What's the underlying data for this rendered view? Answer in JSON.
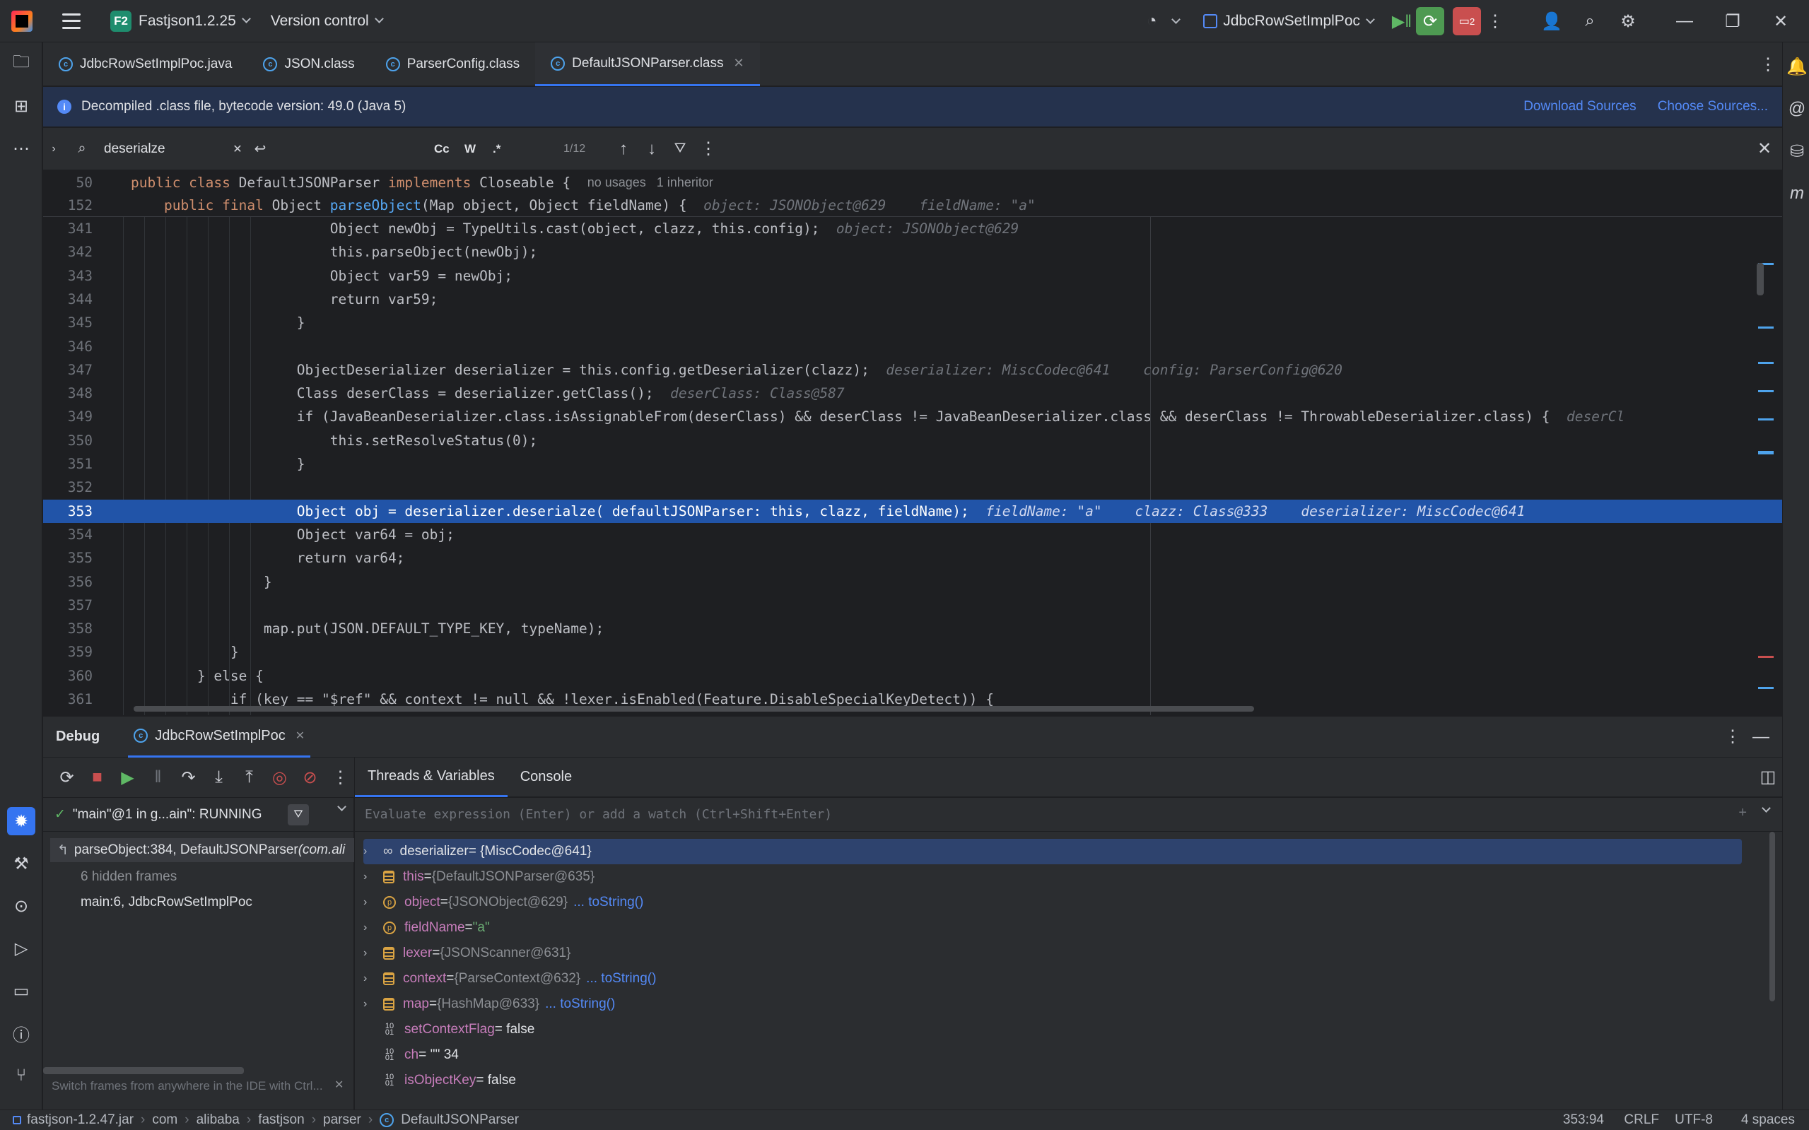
{
  "titlebar": {
    "project_badge": "F2",
    "project": "Fastjson1.2.25",
    "vcs": "Version control",
    "run_config": "JdbcRowSetImplPoc",
    "debug_badge": "2"
  },
  "tabs": [
    {
      "label": "JdbcRowSetImplPoc.java"
    },
    {
      "label": "JSON.class"
    },
    {
      "label": "ParserConfig.class"
    },
    {
      "label": "DefaultJSONParser.class"
    }
  ],
  "banner": {
    "text": "Decompiled .class file, bytecode version: 49.0 (Java 5)",
    "download": "Download Sources",
    "choose": "Choose Sources..."
  },
  "search": {
    "value": "deserialze",
    "count": "1/12",
    "cc": "Cc",
    "w": "W",
    "regex": ".*"
  },
  "code": {
    "sticky1": {
      "ln": "50",
      "a": "public class ",
      "b": "DefaultJSONParser ",
      "c": "implements ",
      "d": "Closeable {  ",
      "e": "no usages   1 inheritor"
    },
    "sticky2": {
      "ln": "152",
      "a": "    public final ",
      "b": "Object ",
      "c": "parseObject",
      "d": "(Map object, Object fieldName) {  ",
      "e": "object: JSONObject@629    fieldName: \"a\""
    },
    "lines": [
      {
        "ln": "341",
        "t": "                        Object newObj = TypeUtils.cast(object, clazz, this.config);",
        "h": "  object: JSONObject@629"
      },
      {
        "ln": "342",
        "t": "                        this.parseObject(newObj);",
        "h": ""
      },
      {
        "ln": "343",
        "t": "                        Object var59 = newObj;",
        "h": ""
      },
      {
        "ln": "344",
        "t": "                        return var59;",
        "h": ""
      },
      {
        "ln": "345",
        "t": "                    }",
        "h": ""
      },
      {
        "ln": "346",
        "t": "",
        "h": ""
      },
      {
        "ln": "347",
        "t": "                    ObjectDeserializer deserializer = this.config.getDeserializer(clazz);",
        "h": "  deserializer: MiscCodec@641    config: ParserConfig@620"
      },
      {
        "ln": "348",
        "t": "                    Class deserClass = deserializer.getClass();",
        "h": "  deserClass: Class@587"
      },
      {
        "ln": "349",
        "t": "                    if (JavaBeanDeserializer.class.isAssignableFrom(deserClass) && deserClass != JavaBeanDeserializer.class && deserClass != ThrowableDeserializer.class) {",
        "h": "  deserCl"
      },
      {
        "ln": "350",
        "t": "                        this.setResolveStatus(0);",
        "h": ""
      },
      {
        "ln": "351",
        "t": "                    }",
        "h": ""
      },
      {
        "ln": "352",
        "t": "",
        "h": ""
      },
      {
        "ln": "353",
        "t": "                    Object obj = deserializer.deserialze( defaultJSONParser: this, clazz, fieldName);",
        "h": "  fieldName: \"a\"    clazz: Class@333    deserializer: MiscCodec@641"
      },
      {
        "ln": "354",
        "t": "                    Object var64 = obj;",
        "h": ""
      },
      {
        "ln": "355",
        "t": "                    return var64;",
        "h": ""
      },
      {
        "ln": "356",
        "t": "                }",
        "h": ""
      },
      {
        "ln": "357",
        "t": "",
        "h": ""
      },
      {
        "ln": "358",
        "t": "                map.put(JSON.DEFAULT_TYPE_KEY, typeName);",
        "h": ""
      },
      {
        "ln": "359",
        "t": "            }",
        "h": ""
      },
      {
        "ln": "360",
        "t": "        } else {",
        "h": ""
      },
      {
        "ln": "361",
        "t": "            if (key == \"$ref\" && context != null && !lexer.isEnabled(Feature.DisableSpecialKeyDetect)) {",
        "h": ""
      }
    ]
  },
  "debug": {
    "title": "Debug",
    "session": "JdbcRowSetImplPoc",
    "threads_tab": "Threads & Variables",
    "console_tab": "Console",
    "thread": "\"main\"@1 in g...ain\": RUNNING",
    "frames": [
      {
        "label": "parseObject:384, DefaultJSONParser ",
        "pkg": "(com.ali"
      },
      {
        "label": "6 hidden frames"
      },
      {
        "label": "main:6, JdbcRowSetImplPoc"
      }
    ],
    "hint": "Switch frames from anywhere in the IDE with Ctrl...",
    "eval_placeholder": "Evaluate expression (Enter) or add a watch (Ctrl+Shift+Enter)",
    "vars": [
      {
        "name": "deserializer",
        "eq": " = {MiscCodec@641}",
        "type": "",
        "link": ""
      },
      {
        "name": "this",
        "eq": " = ",
        "type": "{DefaultJSONParser@635}",
        "link": ""
      },
      {
        "name": "object",
        "eq": " = ",
        "type": "{JSONObject@629}",
        "link": "... toString()"
      },
      {
        "name": "fieldName",
        "eq": " = ",
        "type": "",
        "link": "",
        "str": "\"a\""
      },
      {
        "name": "lexer",
        "eq": " = ",
        "type": "{JSONScanner@631}",
        "link": ""
      },
      {
        "name": "context",
        "eq": " = ",
        "type": "{ParseContext@632}",
        "link": "... toString()"
      },
      {
        "name": "map",
        "eq": " = ",
        "type": "{HashMap@633}",
        "link": "... toString()"
      },
      {
        "name": "setContextFlag",
        "eq": " = false",
        "type": "",
        "link": ""
      },
      {
        "name": "ch",
        "eq": " = '\"' 34",
        "type": "",
        "link": ""
      },
      {
        "name": "isObjectKey",
        "eq": " = false",
        "type": "",
        "link": ""
      }
    ]
  },
  "status": {
    "crumbs": [
      "fastjson-1.2.47.jar",
      "com",
      "alibaba",
      "fastjson",
      "parser",
      "DefaultJSONParser"
    ],
    "pos": "353:94",
    "eol": "CRLF",
    "enc": "UTF-8",
    "indent": "4 spaces"
  },
  "colors": {
    "accent": "#3574f0",
    "selection": "#2154a8",
    "keyword": "#cf8e6d",
    "function": "#56a8f5",
    "field": "#c77dbb"
  }
}
